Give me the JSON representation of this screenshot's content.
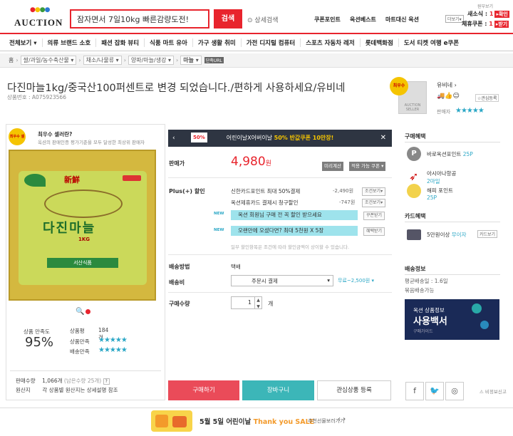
{
  "header": {
    "logo": "AUCTION",
    "search_value": "잠자면서 7일10kg 빠른감량도전!",
    "search_button": "검색",
    "detail_search": "상세검색",
    "links": [
      "쿠폰포인트",
      "옥션베스트",
      "마트대신 옥션"
    ],
    "more_label": "더보기",
    "right_top": "원부보기",
    "new_msg_label": "새소식",
    "new_msg_count": "1",
    "confirm_label": "확인",
    "coupon_label": "제휴쿠폰",
    "coupon_count": "1",
    "receive_label": "받기"
  },
  "gnb": [
    "전체보기",
    "의류 브랜드 소호",
    "패션 잡화 뷰티",
    "식품 마트 유아",
    "가구 생활 취미",
    "가전 디지털 컴퓨터",
    "스포츠 자동차 레저",
    "롯데백화점",
    "도서 티켓 여행 e쿠폰"
  ],
  "breadcrumb": {
    "home": "홈",
    "items": [
      "쌀/과일/농수축산물",
      "채소/나물류",
      "양파/마늘/생강",
      "마늘"
    ],
    "tag": "단축URL"
  },
  "product": {
    "title": "다진마늘1kg/중국산100퍼센트로 변경 되었습니다./편하게 사용하세요/유비네",
    "id_label": "상품번호 : A075923566"
  },
  "seller": {
    "badge": "최우수",
    "box_label": "AUCTION SELLER",
    "name": "유비네",
    "fav_label": "관심등록",
    "pref_label": "판매자",
    "stars": "★★★★★"
  },
  "left": {
    "best_badge": "최우수 셀러",
    "best_title": "최우수 셀러란?",
    "best_desc": "옥션의 판매인증 평가기준을 모두 달성한 최상위 판매자",
    "image_text": {
      "hanja": "新鮮",
      "name": "다진마늘",
      "weight": "1KG",
      "maker": "서산식품"
    },
    "satisfaction_label": "상품 만족도",
    "satisfaction_value": "95%",
    "stats": [
      {
        "label": "상품평",
        "value": "184건"
      },
      {
        "label": "상품만족",
        "value": "★★★★★"
      },
      {
        "label": "배송만족",
        "value": "★★★★★"
      }
    ],
    "sales_label": "판매수량",
    "sales_value": "1,066개",
    "sales_remain": "(남은수량 25개)",
    "origin_label": "원산지",
    "origin_value": "각 상품별 원산지는 상세설명 참조"
  },
  "promo": {
    "badge": "50%",
    "text_a": "어린이날X어버이날",
    "text_b": "50% 반값쿠폰 10만장!"
  },
  "price": {
    "label": "판매가",
    "value": "4,980",
    "unit": "원",
    "calc_btn": "미리계산",
    "coupon_btn": "적용 가능 쿠폰"
  },
  "plus": {
    "label": "Plus(+) 할인",
    "rows": [
      {
        "text": "신한카드포인트 최대 50%결제",
        "amount": "-2,490원",
        "btn": "조건보기"
      },
      {
        "text": "옥션제휴카드 결제시 청구할인",
        "amount": "-747원",
        "btn": "조건보기"
      }
    ],
    "new_label": "NEW",
    "promo_rows": [
      {
        "text": "옥션 회원님 구매 전 꼭 할인 받으세요",
        "btn": "꾸폰받기"
      },
      {
        "text": "오랜만에 오셨다면? 최대 5천원 X 5장",
        "btn": "혜택받기"
      }
    ],
    "note": "일부 할인항목은 조건에 따라 할인금액이 상이할 수 있습니다."
  },
  "shipping": {
    "method_label": "배송방법",
    "method_value": "택배",
    "fee_label": "배송비",
    "fee_select": "주문시 결제",
    "fee_value": "무료~2,500원",
    "qty_label": "구매수량",
    "qty_value": "1",
    "qty_unit": "개"
  },
  "actions": {
    "buy": "구매하기",
    "cart": "장바구니",
    "wish": "관심상품 등록"
  },
  "right": {
    "benefit_title": "구매혜택",
    "benefits": [
      {
        "name": "바로옥션포인트",
        "value": "25P"
      },
      {
        "name": "아시아나항공",
        "value": "2마일"
      },
      {
        "name": "해피 포인트",
        "value": "25P"
      }
    ],
    "card_title": "카드혜택",
    "card_text": "5만원이상",
    "card_value": "무이자",
    "card_btn": "카드보기",
    "delivery_title": "배송정보",
    "avg": "평균배송일 : 1.6일",
    "free": "묶음배송가능",
    "banner_t1": "옥션 상품정보",
    "banner_t2": "사용백서",
    "banner_t3": "구매가이드",
    "report": "비정보신고"
  },
  "footer": {
    "text_a": "5월 5일 어린이날",
    "text_b": "Thank you SALE",
    "sub": "추천선물보러가기"
  }
}
